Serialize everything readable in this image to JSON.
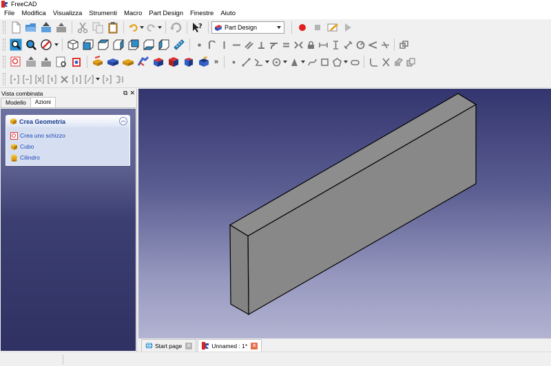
{
  "window": {
    "title": "FreeCAD"
  },
  "menu": [
    "File",
    "Modifica",
    "Visualizza",
    "Strumenti",
    "Macro",
    "Part Design",
    "Finestre",
    "Aiuto"
  ],
  "toolbar": {
    "workbench": "Part Design"
  },
  "panel": {
    "title": "Vista combinata",
    "tabs": [
      "Modello",
      "Azioni"
    ],
    "active_tab": "Azioni",
    "task_group": {
      "title": "Crea Geometria",
      "items": [
        "Crea uno schizzo",
        "Cubo",
        "Cilindro"
      ]
    }
  },
  "documents": [
    {
      "label": "Start page",
      "active": false
    },
    {
      "label": "Unnamed : 1*",
      "active": true
    }
  ],
  "colors": {
    "view_top": "#33356e",
    "view_bottom": "#b3b4d2",
    "shape_face": "#8a8a8a",
    "shape_edge": "#000000",
    "task_link": "#1b46b4",
    "task_title": "#1a3d8f"
  }
}
